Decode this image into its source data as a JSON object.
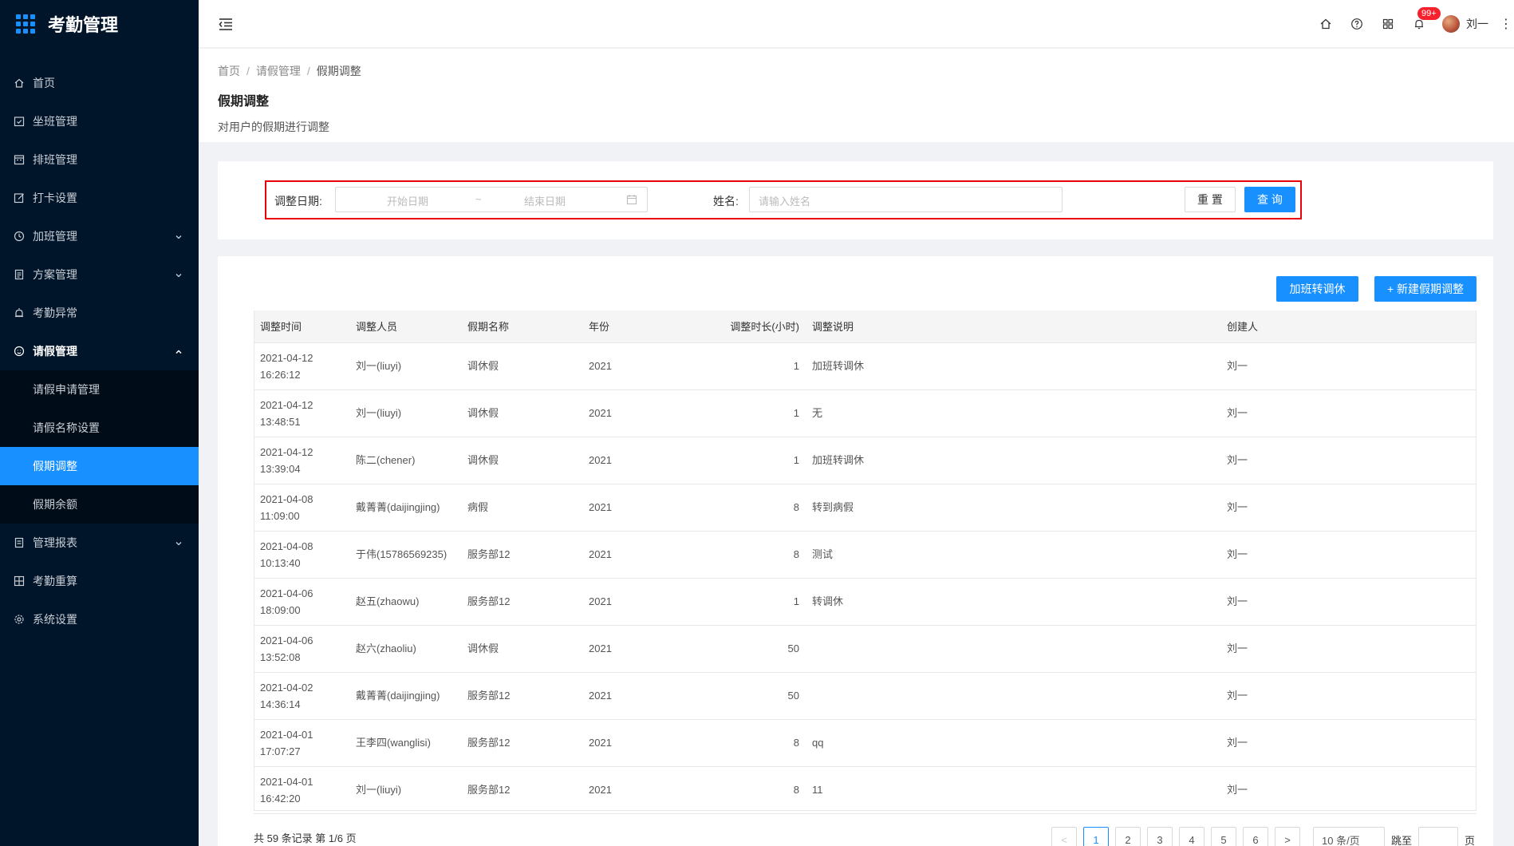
{
  "app": {
    "title": "考勤管理"
  },
  "sidebar": {
    "items": [
      {
        "label": "首页",
        "icon": "home-icon"
      },
      {
        "label": "坐班管理",
        "icon": "calendar-check-icon"
      },
      {
        "label": "排班管理",
        "icon": "calendar-icon"
      },
      {
        "label": "打卡设置",
        "icon": "edit-icon"
      },
      {
        "label": "加班管理",
        "icon": "clock-icon",
        "expandable": true
      },
      {
        "label": "方案管理",
        "icon": "document-icon",
        "expandable": true
      },
      {
        "label": "考勤异常",
        "icon": "alarm-icon"
      },
      {
        "label": "请假管理",
        "icon": "leave-icon",
        "expandable": true,
        "open": true
      },
      {
        "label": "管理报表",
        "icon": "report-icon",
        "expandable": true
      },
      {
        "label": "考勤重算",
        "icon": "calculator-icon"
      },
      {
        "label": "系统设置",
        "icon": "settings-icon"
      }
    ],
    "submenu": [
      {
        "label": "请假申请管理"
      },
      {
        "label": "请假名称设置"
      },
      {
        "label": "假期调整",
        "active": true
      },
      {
        "label": "假期余额"
      }
    ]
  },
  "header": {
    "badge": "99+",
    "user": "刘一"
  },
  "page": {
    "breadcrumb": [
      "首页",
      "请假管理",
      "假期调整"
    ],
    "title": "假期调整",
    "description": "对用户的假期进行调整"
  },
  "filter": {
    "date_label": "调整日期:",
    "start_placeholder": "开始日期",
    "range_sep": "~",
    "end_placeholder": "结束日期",
    "name_label": "姓名:",
    "name_placeholder": "请输入姓名",
    "reset": "重 置",
    "query": "查 询"
  },
  "toolbar": {
    "overtime_to_leave": "加班转调休",
    "new_adjust": "+ 新建假期调整"
  },
  "table": {
    "columns": [
      "调整时间",
      "调整人员",
      "假期名称",
      "年份",
      "调整时长(小时)",
      "调整说明",
      "创建人"
    ],
    "rows": [
      {
        "date": "2021-04-12",
        "time": "16:26:12",
        "person": "刘一(liuyi)",
        "leave": "调休假",
        "year": "2021",
        "hours": "1",
        "note": "加班转调休",
        "creator": "刘一"
      },
      {
        "date": "2021-04-12",
        "time": "13:48:51",
        "person": "刘一(liuyi)",
        "leave": "调休假",
        "year": "2021",
        "hours": "1",
        "note": "无",
        "creator": "刘一"
      },
      {
        "date": "2021-04-12",
        "time": "13:39:04",
        "person": "陈二(chener)",
        "leave": "调休假",
        "year": "2021",
        "hours": "1",
        "note": "加班转调休",
        "creator": "刘一"
      },
      {
        "date": "2021-04-08",
        "time": "11:09:00",
        "person": "戴菁菁(daijingjing)",
        "leave": "病假",
        "year": "2021",
        "hours": "8",
        "note": "转到病假",
        "creator": "刘一"
      },
      {
        "date": "2021-04-08",
        "time": "10:13:40",
        "person": "于伟(15786569235)",
        "leave": "服务部12",
        "year": "2021",
        "hours": "8",
        "note": "测试",
        "creator": "刘一"
      },
      {
        "date": "2021-04-06",
        "time": "18:09:00",
        "person": "赵五(zhaowu)",
        "leave": "服务部12",
        "year": "2021",
        "hours": "1",
        "note": "转调休",
        "creator": "刘一"
      },
      {
        "date": "2021-04-06",
        "time": "13:52:08",
        "person": "赵六(zhaoliu)",
        "leave": "调休假",
        "year": "2021",
        "hours": "50",
        "note": "",
        "creator": "刘一"
      },
      {
        "date": "2021-04-02",
        "time": "14:36:14",
        "person": "戴菁菁(daijingjing)",
        "leave": "服务部12",
        "year": "2021",
        "hours": "50",
        "note": "",
        "creator": "刘一"
      },
      {
        "date": "2021-04-01",
        "time": "17:07:27",
        "person": "王李四(wanglisi)",
        "leave": "服务部12",
        "year": "2021",
        "hours": "8",
        "note": "qq",
        "creator": "刘一"
      },
      {
        "date": "2021-04-01",
        "time": "16:42:20",
        "person": "刘一(liuyi)",
        "leave": "服务部12",
        "year": "2021",
        "hours": "8",
        "note": "11",
        "creator": "刘一"
      }
    ]
  },
  "pagination": {
    "summary": "共 59 条记录 第 1/6 页",
    "pages": [
      "1",
      "2",
      "3",
      "4",
      "5",
      "6"
    ],
    "current": "1",
    "prev": "<",
    "next": ">",
    "page_size": "10 条/页",
    "goto_label": "跳至",
    "goto_suffix": "页"
  },
  "colors": {
    "primary": "#1890ff",
    "sidebar": "#001529",
    "highlight_border": "#e8000b",
    "badge": "#f5222d"
  }
}
